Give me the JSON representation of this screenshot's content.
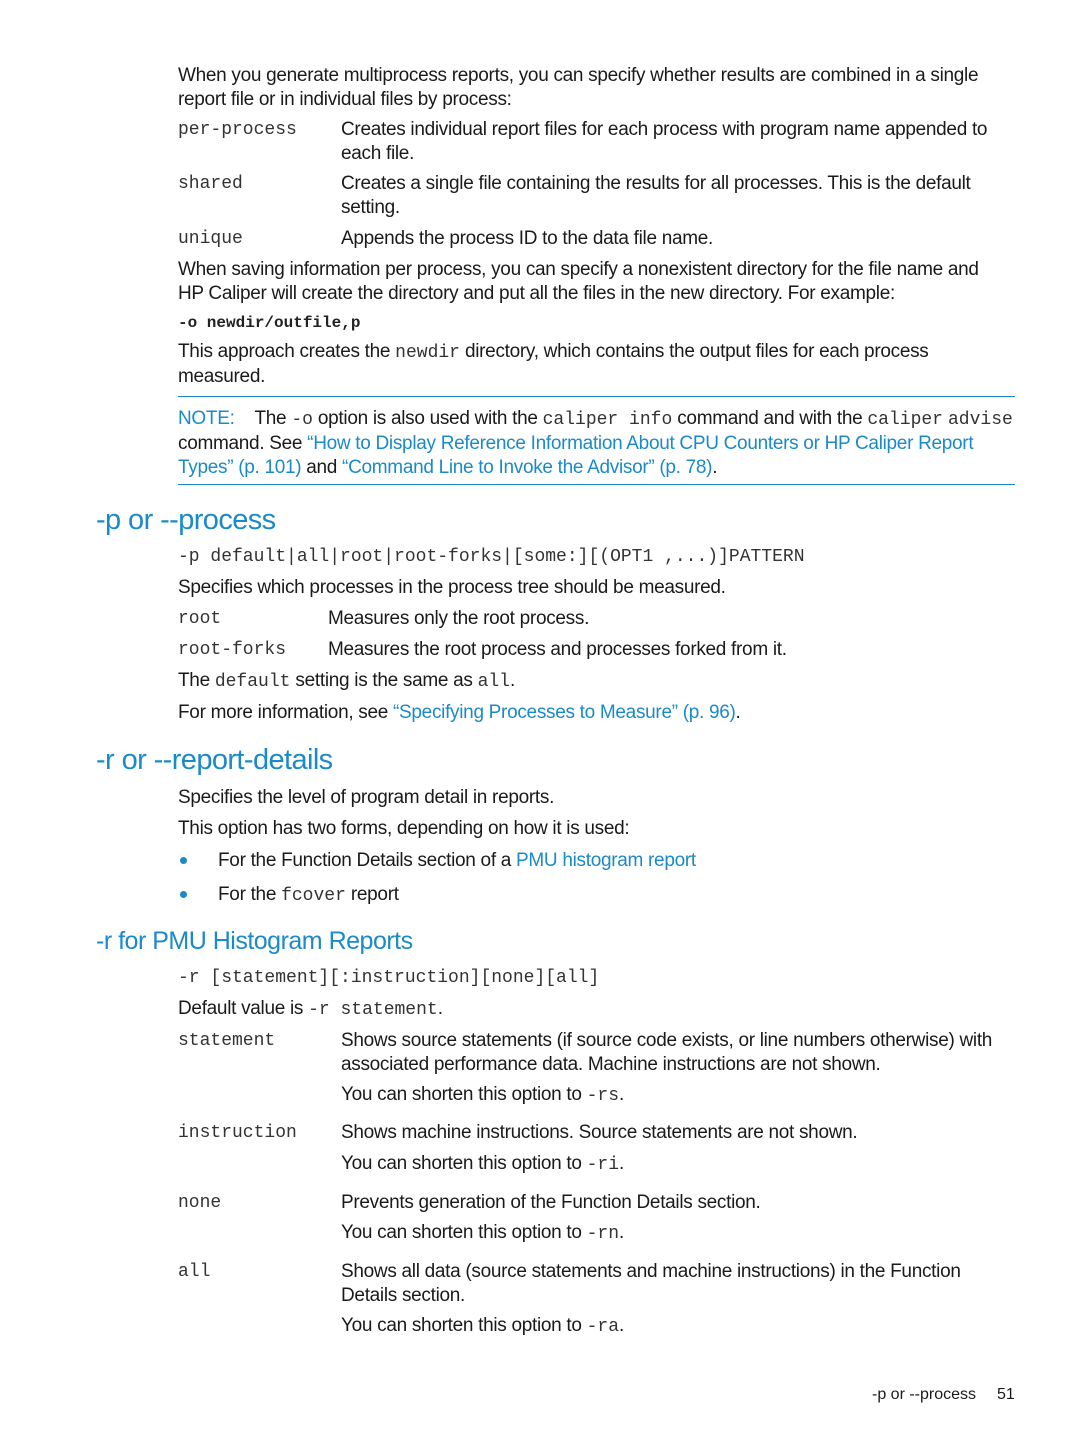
{
  "intro": {
    "paragraph": "When you generate multiprocess reports, you can specify whether results are combined in a single report file or in individual files by process:",
    "options": [
      {
        "term": "per-process",
        "desc": "Creates individual report files for each process with program name appended to each file."
      },
      {
        "term": "shared",
        "desc": "Creates a single file containing the results for all processes. This is the default setting."
      },
      {
        "term": "unique",
        "desc": "Appends the process ID to the data file name."
      }
    ],
    "saving_paragraph": "When saving information per process, you can specify a nonexistent directory for the file name and HP Caliper will create the directory and put all the files in the new directory. For example:",
    "example_code": "-o newdir/outfile,p",
    "approach": {
      "pre": "This approach creates the ",
      "code": "newdir",
      "post": " directory, which contains the output files for each process measured."
    }
  },
  "note": {
    "label": "NOTE:",
    "t1": "The ",
    "c1": "-o",
    "t2": " option is also used with the ",
    "c2": "caliper info",
    "t3": " command and with the ",
    "c3": "caliper",
    "c4": "advise",
    "t4": " command. See ",
    "link1": "“How to Display Reference Information About CPU Counters or HP Caliper Report Types” (p. 101)",
    "t5": " and ",
    "link2": "“Command Line to Invoke the Advisor” (p. 78)",
    "t6": "."
  },
  "process_section": {
    "heading": "-p or --process",
    "syntax": "-p default|all|root|root-forks|[some:][(OPT1 ,...)]PATTERN",
    "description": "Specifies which processes in the process tree should be measured.",
    "options": [
      {
        "term": "root",
        "desc": "Measures only the root process."
      },
      {
        "term": "root-forks",
        "desc": "Measures the root process and processes forked from it."
      }
    ],
    "default_line": {
      "t1": "The ",
      "c1": "default",
      "t2": " setting is the same as ",
      "c2": "all",
      "t3": "."
    },
    "more_info": {
      "pre": "For more information, see ",
      "link": "“Specifying Processes to Measure” (p. 96)",
      "post": "."
    }
  },
  "report_section": {
    "heading": "-r or --report-details",
    "line1": "Specifies the level of program detail in reports.",
    "line2": "This option has two forms, depending on how it is used:",
    "bullets": [
      {
        "pre": "For the Function Details section of a ",
        "link": "PMU histogram report",
        "code": "",
        "post": ""
      },
      {
        "pre": "For the ",
        "link": "",
        "code": "fcover",
        "post": " report"
      }
    ]
  },
  "pmu_section": {
    "heading": "-r for PMU Histogram Reports",
    "syntax": "-r [statement][:instruction][none][all]",
    "default": {
      "pre": "Default value is ",
      "code": "-r statement",
      "post": "."
    },
    "options": [
      {
        "term": "statement",
        "desc": "Shows source statements (if source code exists, or line numbers otherwise) with associated performance data. Machine instructions are not shown.",
        "short_pre": "You can shorten this option to ",
        "short_code": "-rs",
        "short_post": "."
      },
      {
        "term": "instruction",
        "desc": "Shows machine instructions. Source statements are not shown.",
        "short_pre": "You can shorten this option to ",
        "short_code": "-ri",
        "short_post": "."
      },
      {
        "term": "none",
        "desc": "Prevents generation of the Function Details section.",
        "short_pre": "You can shorten this option to ",
        "short_code": "-rn",
        "short_post": "."
      },
      {
        "term": "all",
        "desc": "Shows all data (source statements and machine instructions) in the Function Details section.",
        "short_pre": "You can shorten this option to ",
        "short_code": "-ra",
        "short_post": "."
      }
    ]
  },
  "footer": {
    "section": "-p or --process",
    "page_number": "51"
  },
  "colors": {
    "accent": "#1a8ac8",
    "text": "#1a1a1a"
  }
}
